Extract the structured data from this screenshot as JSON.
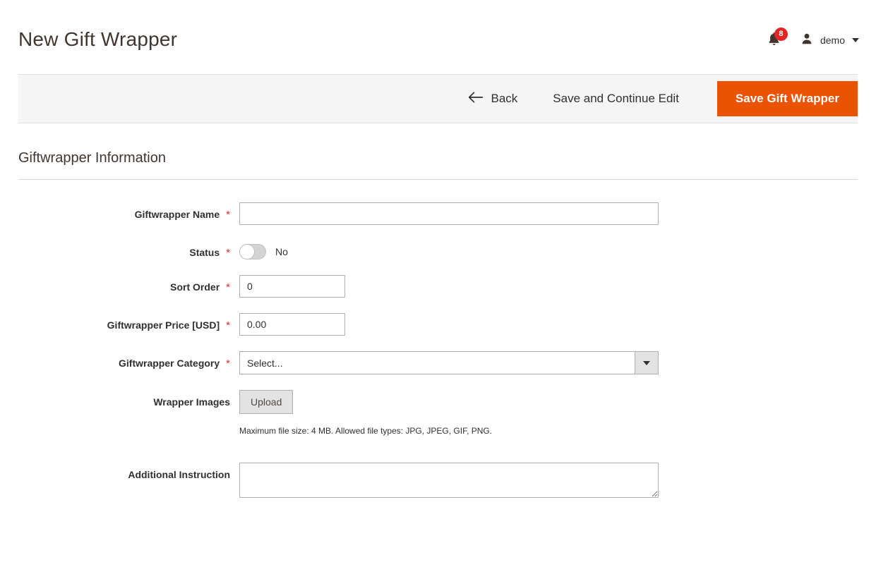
{
  "header": {
    "title": "New Gift Wrapper",
    "notifications": {
      "icon": "bell-icon",
      "count": "8"
    },
    "user": {
      "icon": "user-avatar-icon",
      "name": "demo",
      "caret": "chevron-down-icon"
    }
  },
  "toolbar": {
    "back_label": "Back",
    "back_icon": "arrow-left-icon",
    "save_continue_label": "Save and Continue Edit",
    "save_label": "Save Gift Wrapper",
    "primary_color": "#eb5202"
  },
  "section": {
    "title": "Giftwrapper Information"
  },
  "fields": {
    "name": {
      "label": "Giftwrapper Name",
      "required": "*",
      "value": "",
      "placeholder": ""
    },
    "status": {
      "label": "Status",
      "required": "*",
      "state_label": "No",
      "checked": false
    },
    "sort_order": {
      "label": "Sort Order",
      "required": "*",
      "value": "0"
    },
    "price": {
      "label": "Giftwrapper Price [USD]",
      "required": "*",
      "value": "0.00"
    },
    "category": {
      "label": "Giftwrapper Category",
      "required": "*",
      "value": "Select...",
      "options": [
        "Select..."
      ]
    },
    "images": {
      "label": "Wrapper Images",
      "upload_label": "Upload",
      "note": "Maximum file size: 4 MB. Allowed file types: JPG, JPEG, GIF, PNG."
    },
    "instruction": {
      "label": "Additional Instruction",
      "value": "",
      "placeholder": ""
    }
  }
}
